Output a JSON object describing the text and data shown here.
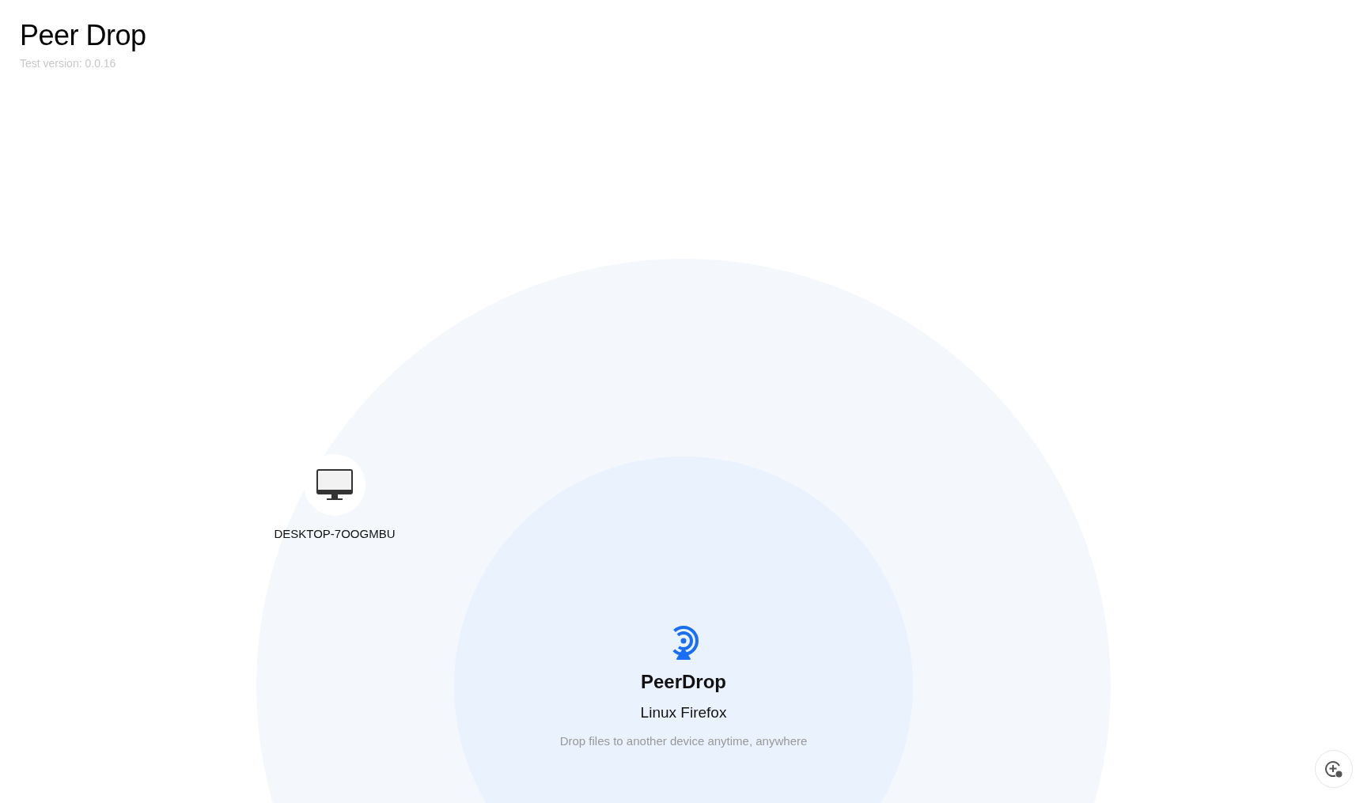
{
  "header": {
    "title": "Peer Drop",
    "version": "Test version: 0.0.16"
  },
  "peers": [
    {
      "kind": "desktop",
      "name": "DESKTOP-7OOGMBU"
    }
  ],
  "self": {
    "app_name": "PeerDrop",
    "device": "Linux Firefox",
    "tagline": "Drop files to another device anytime, anywhere"
  }
}
